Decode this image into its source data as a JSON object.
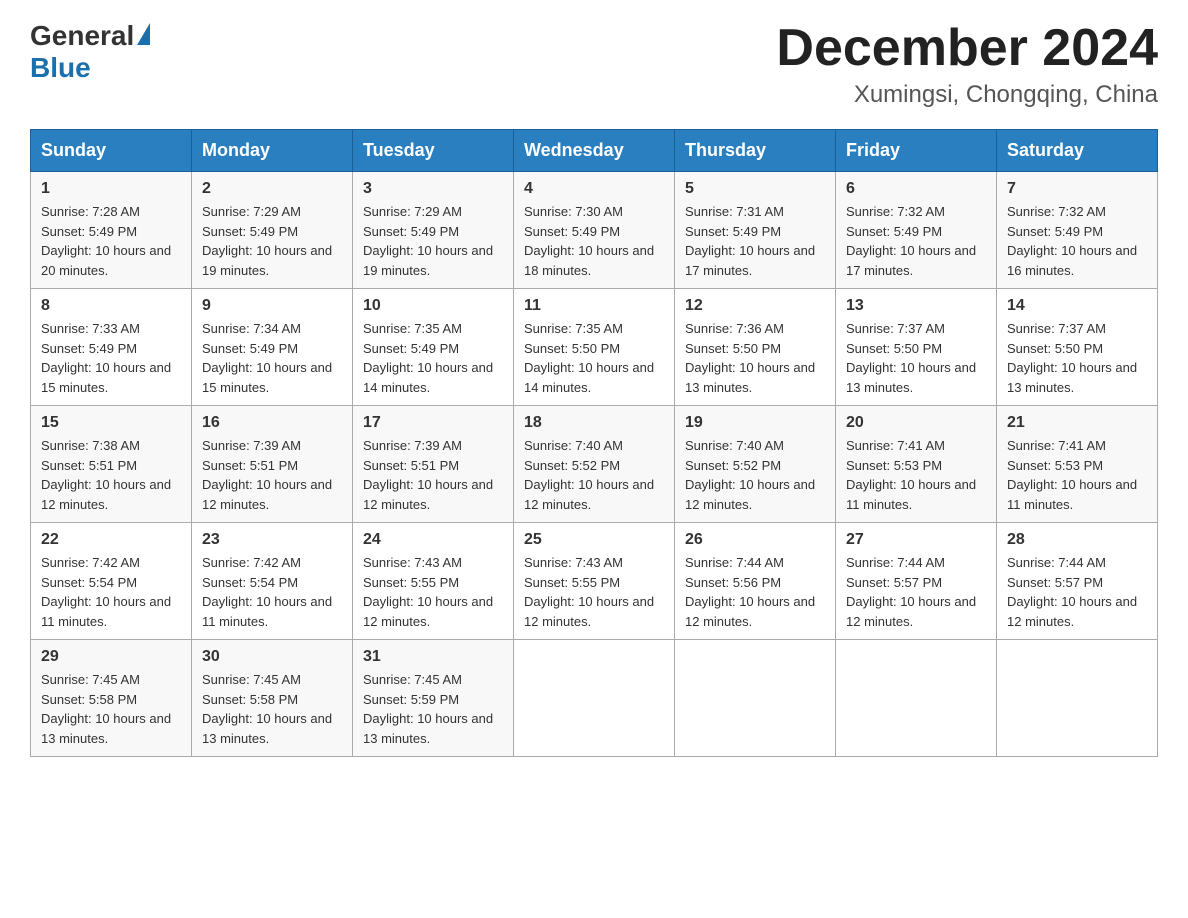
{
  "header": {
    "logo_general": "General",
    "logo_blue": "Blue",
    "month_title": "December 2024",
    "location": "Xumingsi, Chongqing, China"
  },
  "days_of_week": [
    "Sunday",
    "Monday",
    "Tuesday",
    "Wednesday",
    "Thursday",
    "Friday",
    "Saturday"
  ],
  "weeks": [
    [
      {
        "day": "1",
        "sunrise": "7:28 AM",
        "sunset": "5:49 PM",
        "daylight": "10 hours and 20 minutes."
      },
      {
        "day": "2",
        "sunrise": "7:29 AM",
        "sunset": "5:49 PM",
        "daylight": "10 hours and 19 minutes."
      },
      {
        "day": "3",
        "sunrise": "7:29 AM",
        "sunset": "5:49 PM",
        "daylight": "10 hours and 19 minutes."
      },
      {
        "day": "4",
        "sunrise": "7:30 AM",
        "sunset": "5:49 PM",
        "daylight": "10 hours and 18 minutes."
      },
      {
        "day": "5",
        "sunrise": "7:31 AM",
        "sunset": "5:49 PM",
        "daylight": "10 hours and 17 minutes."
      },
      {
        "day": "6",
        "sunrise": "7:32 AM",
        "sunset": "5:49 PM",
        "daylight": "10 hours and 17 minutes."
      },
      {
        "day": "7",
        "sunrise": "7:32 AM",
        "sunset": "5:49 PM",
        "daylight": "10 hours and 16 minutes."
      }
    ],
    [
      {
        "day": "8",
        "sunrise": "7:33 AM",
        "sunset": "5:49 PM",
        "daylight": "10 hours and 15 minutes."
      },
      {
        "day": "9",
        "sunrise": "7:34 AM",
        "sunset": "5:49 PM",
        "daylight": "10 hours and 15 minutes."
      },
      {
        "day": "10",
        "sunrise": "7:35 AM",
        "sunset": "5:49 PM",
        "daylight": "10 hours and 14 minutes."
      },
      {
        "day": "11",
        "sunrise": "7:35 AM",
        "sunset": "5:50 PM",
        "daylight": "10 hours and 14 minutes."
      },
      {
        "day": "12",
        "sunrise": "7:36 AM",
        "sunset": "5:50 PM",
        "daylight": "10 hours and 13 minutes."
      },
      {
        "day": "13",
        "sunrise": "7:37 AM",
        "sunset": "5:50 PM",
        "daylight": "10 hours and 13 minutes."
      },
      {
        "day": "14",
        "sunrise": "7:37 AM",
        "sunset": "5:50 PM",
        "daylight": "10 hours and 13 minutes."
      }
    ],
    [
      {
        "day": "15",
        "sunrise": "7:38 AM",
        "sunset": "5:51 PM",
        "daylight": "10 hours and 12 minutes."
      },
      {
        "day": "16",
        "sunrise": "7:39 AM",
        "sunset": "5:51 PM",
        "daylight": "10 hours and 12 minutes."
      },
      {
        "day": "17",
        "sunrise": "7:39 AM",
        "sunset": "5:51 PM",
        "daylight": "10 hours and 12 minutes."
      },
      {
        "day": "18",
        "sunrise": "7:40 AM",
        "sunset": "5:52 PM",
        "daylight": "10 hours and 12 minutes."
      },
      {
        "day": "19",
        "sunrise": "7:40 AM",
        "sunset": "5:52 PM",
        "daylight": "10 hours and 12 minutes."
      },
      {
        "day": "20",
        "sunrise": "7:41 AM",
        "sunset": "5:53 PM",
        "daylight": "10 hours and 11 minutes."
      },
      {
        "day": "21",
        "sunrise": "7:41 AM",
        "sunset": "5:53 PM",
        "daylight": "10 hours and 11 minutes."
      }
    ],
    [
      {
        "day": "22",
        "sunrise": "7:42 AM",
        "sunset": "5:54 PM",
        "daylight": "10 hours and 11 minutes."
      },
      {
        "day": "23",
        "sunrise": "7:42 AM",
        "sunset": "5:54 PM",
        "daylight": "10 hours and 11 minutes."
      },
      {
        "day": "24",
        "sunrise": "7:43 AM",
        "sunset": "5:55 PM",
        "daylight": "10 hours and 12 minutes."
      },
      {
        "day": "25",
        "sunrise": "7:43 AM",
        "sunset": "5:55 PM",
        "daylight": "10 hours and 12 minutes."
      },
      {
        "day": "26",
        "sunrise": "7:44 AM",
        "sunset": "5:56 PM",
        "daylight": "10 hours and 12 minutes."
      },
      {
        "day": "27",
        "sunrise": "7:44 AM",
        "sunset": "5:57 PM",
        "daylight": "10 hours and 12 minutes."
      },
      {
        "day": "28",
        "sunrise": "7:44 AM",
        "sunset": "5:57 PM",
        "daylight": "10 hours and 12 minutes."
      }
    ],
    [
      {
        "day": "29",
        "sunrise": "7:45 AM",
        "sunset": "5:58 PM",
        "daylight": "10 hours and 13 minutes."
      },
      {
        "day": "30",
        "sunrise": "7:45 AM",
        "sunset": "5:58 PM",
        "daylight": "10 hours and 13 minutes."
      },
      {
        "day": "31",
        "sunrise": "7:45 AM",
        "sunset": "5:59 PM",
        "daylight": "10 hours and 13 minutes."
      },
      null,
      null,
      null,
      null
    ]
  ]
}
